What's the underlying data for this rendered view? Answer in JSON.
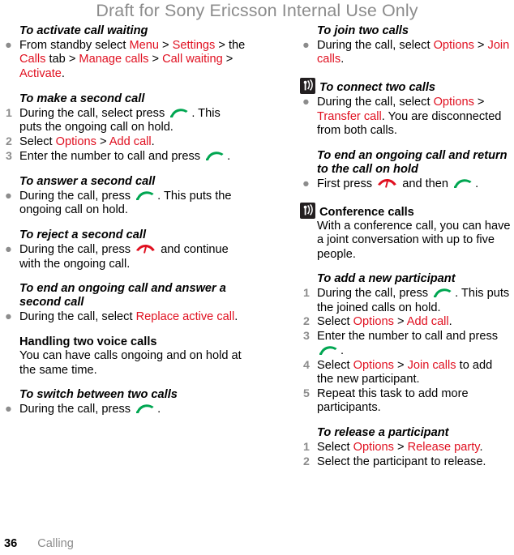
{
  "header": {
    "draft_notice": "Draft for Sony Ericsson Internal Use Only"
  },
  "footer": {
    "page_number": "36",
    "chapter": "Calling"
  },
  "colors": {
    "link_red": "#e01020",
    "marker_gray": "#8c8c8c",
    "header_gray": "#8c8c8c",
    "call_key_green": "#00a651",
    "end_key_red": "#e01020",
    "operator_icon_bg": "#231f20"
  },
  "icons": {
    "call_key": "green-call-key-icon",
    "end_key": "red-end-call-key-icon",
    "operator_dependent": "operator-network-icon"
  },
  "left_column": {
    "sections": [
      {
        "heading": "To activate call waiting",
        "heading_style": "task",
        "bullets": [
          {
            "parts": [
              {
                "t": "From standby select ",
                "c": "blk"
              },
              {
                "t": "Menu",
                "c": "red"
              },
              {
                "t": " > ",
                "c": "blk"
              },
              {
                "t": "Settings",
                "c": "red"
              },
              {
                "t": " > the ",
                "c": "blk"
              },
              {
                "t": "Calls",
                "c": "red"
              },
              {
                "t": " tab > ",
                "c": "blk"
              },
              {
                "t": "Manage calls",
                "c": "red"
              },
              {
                "t": " > ",
                "c": "blk"
              },
              {
                "t": "Call waiting",
                "c": "red"
              },
              {
                "t": " > ",
                "c": "blk"
              },
              {
                "t": "Activate",
                "c": "red"
              },
              {
                "t": ".",
                "c": "blk"
              }
            ]
          }
        ]
      },
      {
        "heading": "To make a second call",
        "heading_style": "task",
        "steps": [
          {
            "number": "1",
            "parts": [
              {
                "t": "During the call, select press ",
                "c": "blk"
              },
              {
                "t": "",
                "c": "icon-call"
              },
              {
                "t": ". This puts the ongoing call on hold.",
                "c": "blk"
              }
            ]
          },
          {
            "number": "2",
            "parts": [
              {
                "t": "Select ",
                "c": "blk"
              },
              {
                "t": "Options",
                "c": "red"
              },
              {
                "t": " > ",
                "c": "blk"
              },
              {
                "t": "Add call",
                "c": "red"
              },
              {
                "t": ".",
                "c": "blk"
              }
            ]
          },
          {
            "number": "3",
            "parts": [
              {
                "t": "Enter the number to call and press ",
                "c": "blk"
              },
              {
                "t": "",
                "c": "icon-call"
              },
              {
                "t": ".",
                "c": "blk"
              }
            ]
          }
        ]
      },
      {
        "heading": "To answer a second call",
        "heading_style": "task",
        "bullets": [
          {
            "parts": [
              {
                "t": "During the call, press ",
                "c": "blk"
              },
              {
                "t": "",
                "c": "icon-call"
              },
              {
                "t": ". This puts the ongoing call on hold.",
                "c": "blk"
              }
            ]
          }
        ]
      },
      {
        "heading": "To reject a second call",
        "heading_style": "task",
        "bullets": [
          {
            "parts": [
              {
                "t": "During the call, press ",
                "c": "blk"
              },
              {
                "t": "",
                "c": "icon-end"
              },
              {
                "t": " and continue with the ongoing call.",
                "c": "blk"
              }
            ]
          }
        ]
      },
      {
        "heading": "To end an ongoing call and answer a second call",
        "heading_style": "task",
        "bullets": [
          {
            "parts": [
              {
                "t": "During the call, select ",
                "c": "blk"
              },
              {
                "t": "Replace active call",
                "c": "red"
              },
              {
                "t": ".",
                "c": "blk"
              }
            ]
          }
        ]
      },
      {
        "heading": "Handling two voice calls",
        "heading_style": "section",
        "paragraph": "You can have calls ongoing and on hold at the same time."
      },
      {
        "heading": "To switch between two calls",
        "heading_style": "task",
        "bullets": [
          {
            "parts": [
              {
                "t": "During the call, press ",
                "c": "blk"
              },
              {
                "t": "",
                "c": "icon-call"
              },
              {
                "t": ".",
                "c": "blk"
              }
            ]
          }
        ]
      }
    ]
  },
  "right_column": {
    "sections": [
      {
        "heading": "To join two calls",
        "heading_style": "task",
        "bullets": [
          {
            "parts": [
              {
                "t": "During the call, select ",
                "c": "blk"
              },
              {
                "t": "Options",
                "c": "red"
              },
              {
                "t": " > ",
                "c": "blk"
              },
              {
                "t": "Join calls",
                "c": "red"
              },
              {
                "t": ".",
                "c": "blk"
              }
            ]
          }
        ]
      },
      {
        "heading": "To connect two calls",
        "heading_style": "task",
        "has_operator_icon": true,
        "bullets": [
          {
            "parts": [
              {
                "t": "During the call, select ",
                "c": "blk"
              },
              {
                "t": "Options",
                "c": "red"
              },
              {
                "t": " > ",
                "c": "blk"
              },
              {
                "t": "Transfer call",
                "c": "red"
              },
              {
                "t": ". You are disconnected from both calls.",
                "c": "blk"
              }
            ]
          }
        ]
      },
      {
        "heading": "To end an ongoing call and return to the call on hold",
        "heading_style": "task",
        "bullets": [
          {
            "parts": [
              {
                "t": "First press ",
                "c": "blk"
              },
              {
                "t": "",
                "c": "icon-end"
              },
              {
                "t": " and then ",
                "c": "blk"
              },
              {
                "t": "",
                "c": "icon-call"
              },
              {
                "t": ".",
                "c": "blk"
              }
            ]
          }
        ]
      },
      {
        "heading": "Conference calls",
        "heading_style": "section",
        "has_operator_icon": true,
        "paragraph": "With a conference call, you can have a joint conversation with up to five people."
      },
      {
        "heading": "To add a new participant",
        "heading_style": "task",
        "steps": [
          {
            "number": "1",
            "parts": [
              {
                "t": "During the call, press ",
                "c": "blk"
              },
              {
                "t": "",
                "c": "icon-call"
              },
              {
                "t": ". This puts the joined calls on hold.",
                "c": "blk"
              }
            ]
          },
          {
            "number": "2",
            "parts": [
              {
                "t": "Select ",
                "c": "blk"
              },
              {
                "t": "Options",
                "c": "red"
              },
              {
                "t": " > ",
                "c": "blk"
              },
              {
                "t": "Add call",
                "c": "red"
              },
              {
                "t": ".",
                "c": "blk"
              }
            ]
          },
          {
            "number": "3",
            "parts": [
              {
                "t": "Enter the number to call and press ",
                "c": "blk"
              },
              {
                "t": "",
                "c": "icon-call"
              },
              {
                "t": ".",
                "c": "blk"
              }
            ]
          },
          {
            "number": "4",
            "parts": [
              {
                "t": "Select ",
                "c": "blk"
              },
              {
                "t": "Options",
                "c": "red"
              },
              {
                "t": " > ",
                "c": "blk"
              },
              {
                "t": "Join calls",
                "c": "red"
              },
              {
                "t": " to add the new participant.",
                "c": "blk"
              }
            ]
          },
          {
            "number": "5",
            "parts": [
              {
                "t": "Repeat this task to add more participants.",
                "c": "blk"
              }
            ]
          }
        ]
      },
      {
        "heading": "To release a participant",
        "heading_style": "task",
        "steps": [
          {
            "number": "1",
            "parts": [
              {
                "t": "Select ",
                "c": "blk"
              },
              {
                "t": "Options",
                "c": "red"
              },
              {
                "t": " > ",
                "c": "blk"
              },
              {
                "t": "Release party",
                "c": "red"
              },
              {
                "t": ".",
                "c": "blk"
              }
            ]
          },
          {
            "number": "2",
            "parts": [
              {
                "t": "Select the participant to release.",
                "c": "blk"
              }
            ]
          }
        ]
      }
    ]
  },
  "bullet_glyph": "●"
}
